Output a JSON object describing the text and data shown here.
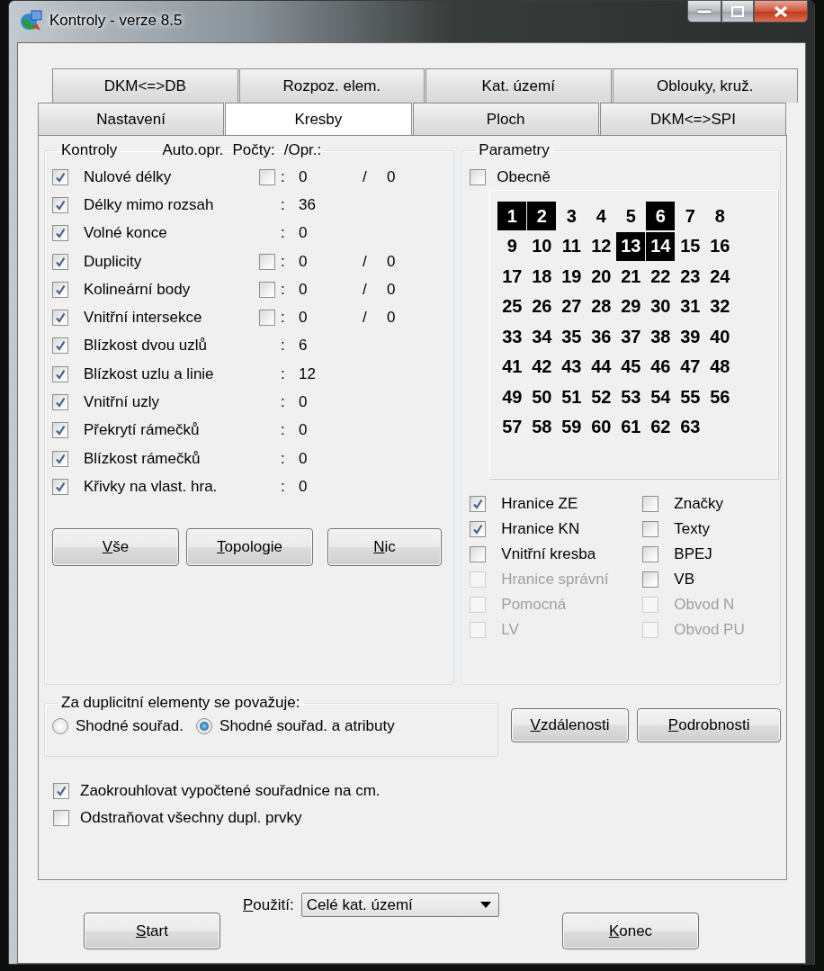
{
  "window": {
    "title": "Kontroly - verze 8.5"
  },
  "tabs_back": [
    {
      "label": "DKM<=>DB",
      "selected": false
    },
    {
      "label": "Rozpoz. elem.",
      "selected": false
    },
    {
      "label": "Kat. území",
      "selected": false
    },
    {
      "label": "Oblouky, kruž.",
      "selected": false
    }
  ],
  "tabs_front": [
    {
      "label": "Nastavení",
      "selected": false
    },
    {
      "label": "Kresby",
      "selected": true
    },
    {
      "label": "Ploch",
      "selected": false
    },
    {
      "label": "DKM<=>SPI",
      "selected": false
    }
  ],
  "checks": {
    "title": "Kontroly",
    "columns": [
      "Auto.opr.",
      "Počty:",
      "/Opr.:"
    ],
    "rows": [
      {
        "label": "Nulové délky",
        "checked": true,
        "auto_fix": false,
        "colon": ":",
        "count": "0",
        "slash": "/",
        "corrected": "0"
      },
      {
        "label": "Délky mimo rozsah",
        "checked": true,
        "colon": ":",
        "count": "36"
      },
      {
        "label": "Volné konce",
        "checked": true,
        "colon": ":",
        "count": "0"
      },
      {
        "label": "Duplicity",
        "checked": true,
        "auto_fix": false,
        "colon": ":",
        "count": "0",
        "slash": "/",
        "corrected": "0"
      },
      {
        "label": "Kolineární body",
        "checked": true,
        "auto_fix": false,
        "colon": ":",
        "count": "0",
        "slash": "/",
        "corrected": "0"
      },
      {
        "label": "Vnitřní intersekce",
        "checked": true,
        "auto_fix": false,
        "colon": ":",
        "count": "0",
        "slash": "/",
        "corrected": "0"
      },
      {
        "label": "Blízkost dvou uzlů",
        "checked": true,
        "colon": ":",
        "count": "6"
      },
      {
        "label": "Blízkost uzlu a linie",
        "checked": true,
        "colon": ":",
        "count": "12"
      },
      {
        "label": "Vnitřní uzly",
        "checked": true,
        "colon": ":",
        "count": "0"
      },
      {
        "label": "Překrytí rámečků",
        "checked": true,
        "colon": ":",
        "count": "0"
      },
      {
        "label": "Blízkost rámečků",
        "checked": true,
        "colon": ":",
        "count": "0"
      },
      {
        "label": "Křivky na vlast. hra.",
        "checked": true,
        "colon": ":",
        "count": "0"
      }
    ],
    "buttons": [
      {
        "label": "Vše"
      },
      {
        "label": "Topologie"
      },
      {
        "label": "Nic"
      }
    ]
  },
  "parameters": {
    "title": "Parametry",
    "general": {
      "label": "Obecně",
      "checked": false
    },
    "layers": [
      {
        "label": "1",
        "selected": true
      },
      {
        "label": "2",
        "selected": true
      },
      {
        "label": "3",
        "selected": false
      },
      {
        "label": "4",
        "selected": false
      },
      {
        "label": "5",
        "selected": false
      },
      {
        "label": "6",
        "selected": true
      },
      {
        "label": "7",
        "selected": false
      },
      {
        "label": "8",
        "selected": false
      },
      {
        "label": "9",
        "selected": false
      },
      {
        "label": "10",
        "selected": false
      },
      {
        "label": "11",
        "selected": false
      },
      {
        "label": "12",
        "selected": false
      },
      {
        "label": "13",
        "selected": true
      },
      {
        "label": "14",
        "selected": true
      },
      {
        "label": "15",
        "selected": false
      },
      {
        "label": "16",
        "selected": false
      },
      {
        "label": "17",
        "selected": false
      },
      {
        "label": "18",
        "selected": false
      },
      {
        "label": "19",
        "selected": false
      },
      {
        "label": "20",
        "selected": false
      },
      {
        "label": "21",
        "selected": false
      },
      {
        "label": "22",
        "selected": false
      },
      {
        "label": "23",
        "selected": false
      },
      {
        "label": "24",
        "selected": false
      },
      {
        "label": "25",
        "selected": false
      },
      {
        "label": "26",
        "selected": false
      },
      {
        "label": "27",
        "selected": false
      },
      {
        "label": "28",
        "selected": false
      },
      {
        "label": "29",
        "selected": false
      },
      {
        "label": "30",
        "selected": false
      },
      {
        "label": "31",
        "selected": false
      },
      {
        "label": "32",
        "selected": false
      },
      {
        "label": "33",
        "selected": false
      },
      {
        "label": "34",
        "selected": false
      },
      {
        "label": "35",
        "selected": false
      },
      {
        "label": "36",
        "selected": false
      },
      {
        "label": "37",
        "selected": false
      },
      {
        "label": "38",
        "selected": false
      },
      {
        "label": "39",
        "selected": false
      },
      {
        "label": "40",
        "selected": false
      },
      {
        "label": "41",
        "selected": false
      },
      {
        "label": "42",
        "selected": false
      },
      {
        "label": "43",
        "selected": false
      },
      {
        "label": "44",
        "selected": false
      },
      {
        "label": "45",
        "selected": false
      },
      {
        "label": "46",
        "selected": false
      },
      {
        "label": "47",
        "selected": false
      },
      {
        "label": "48",
        "selected": false
      },
      {
        "label": "49",
        "selected": false
      },
      {
        "label": "50",
        "selected": false
      },
      {
        "label": "51",
        "selected": false
      },
      {
        "label": "52",
        "selected": false
      },
      {
        "label": "53",
        "selected": false
      },
      {
        "label": "54",
        "selected": false
      },
      {
        "label": "55",
        "selected": false
      },
      {
        "label": "56",
        "selected": false
      },
      {
        "label": "57",
        "selected": false
      },
      {
        "label": "58",
        "selected": false
      },
      {
        "label": "59",
        "selected": false
      },
      {
        "label": "60",
        "selected": false
      },
      {
        "label": "61",
        "selected": false
      },
      {
        "label": "62",
        "selected": false
      },
      {
        "label": "63",
        "selected": false
      }
    ],
    "options": [
      {
        "label": "Hranice ZE",
        "checked": true,
        "disabled": false
      },
      {
        "label": "Značky",
        "checked": false,
        "disabled": false
      },
      {
        "label": "Hranice KN",
        "checked": true,
        "disabled": false
      },
      {
        "label": "Texty",
        "checked": false,
        "disabled": false
      },
      {
        "label": "Vnitřní kresba",
        "checked": false,
        "disabled": false
      },
      {
        "label": "BPEJ",
        "checked": false,
        "disabled": false
      },
      {
        "label": "Hranice správní",
        "checked": false,
        "disabled": true
      },
      {
        "label": "VB",
        "checked": false,
        "disabled": false
      },
      {
        "label": "Pomocná",
        "checked": false,
        "disabled": true
      },
      {
        "label": "Obvod N",
        "checked": false,
        "disabled": true
      },
      {
        "label": "LV",
        "checked": false,
        "disabled": true
      },
      {
        "label": "Obvod PU",
        "checked": false,
        "disabled": true
      }
    ]
  },
  "duplicates": {
    "title": "Za duplicitní elementy se považuje:",
    "options": [
      {
        "label": "Shodné souřad.",
        "selected": false
      },
      {
        "label": "Shodné souřad. a atributy",
        "selected": true
      }
    ]
  },
  "side_buttons": [
    {
      "label": "Vzdálenosti"
    },
    {
      "label": "Podrobnosti"
    }
  ],
  "flags": [
    {
      "label": "Zaokrouhlovat vypočtené souřadnice na cm.",
      "checked": true
    },
    {
      "label": "Odstraňovat všechny dupl. prvky",
      "checked": false
    }
  ],
  "footer": {
    "scope": {
      "label": "Použití:",
      "value": "Celé kat. území"
    },
    "buttons": [
      {
        "label": "Start"
      },
      {
        "label": "Konec"
      }
    ]
  }
}
